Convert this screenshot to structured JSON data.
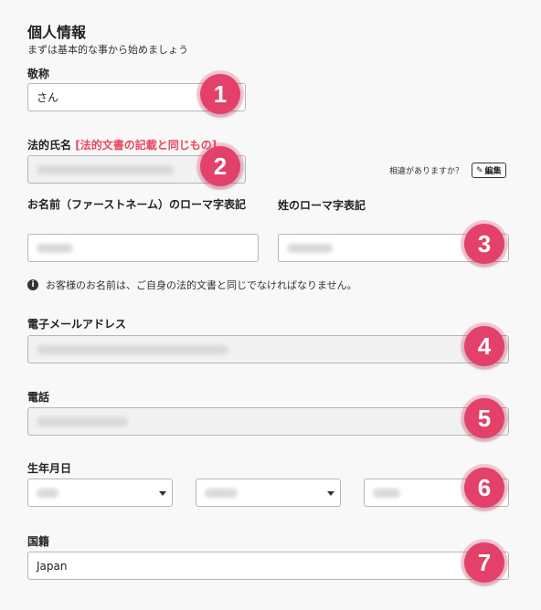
{
  "header": {
    "title": "個人情報",
    "subtitle": "まずは基本的な事から始めましょう"
  },
  "honorific": {
    "label": "敬称",
    "value": "さん"
  },
  "legal_name": {
    "label": "法的氏名",
    "note": "[法的文書の記載と同じもの]",
    "mismatch_text": "相違がありますか？",
    "edit_label": "編集"
  },
  "first_name_romaji": {
    "label": "お名前（ファーストネーム）のローマ字表記"
  },
  "last_name_romaji": {
    "label": "姓のローマ字表記"
  },
  "name_notice": "お客様のお名前は、ご自身の法的文書と同じでなければなりません。",
  "email": {
    "label": "電子メールアドレス"
  },
  "phone": {
    "label": "電話"
  },
  "birthdate": {
    "label": "生年月日"
  },
  "nationality": {
    "label": "国籍",
    "value": "Japan"
  },
  "badges": [
    "1",
    "2",
    "3",
    "4",
    "5",
    "6",
    "7"
  ],
  "colors": {
    "badge": "#e3406a",
    "required_note": "#e8475f"
  }
}
